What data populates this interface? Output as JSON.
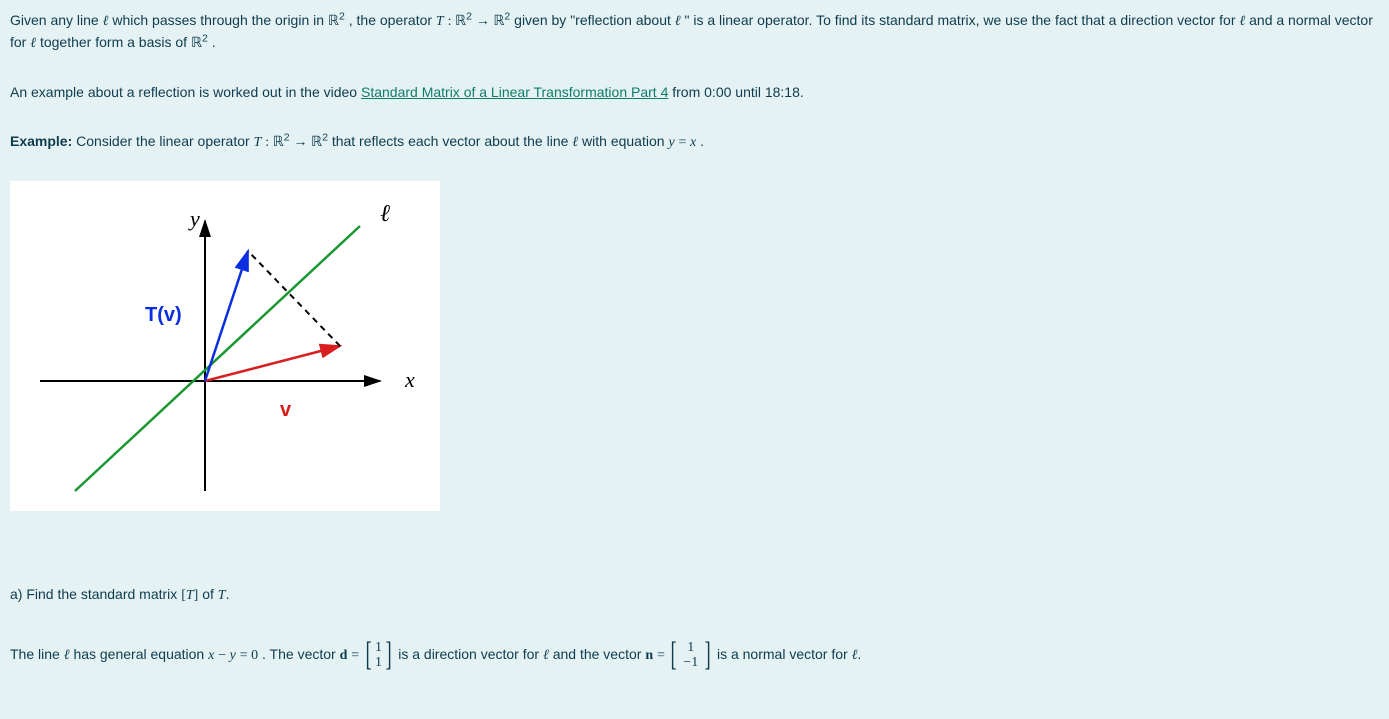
{
  "para1": {
    "t1": "Given any line ",
    "ell1": "ℓ",
    "t2": " which passes through the origin in ",
    "R": "ℝ",
    "sq": "2",
    "t3": ", the operator ",
    "T": "T",
    "colon": " : ",
    "arrow": " → ",
    "t4": " given by \"reflection about ",
    "ell2": "ℓ",
    "t5": "\" is a linear operator.  To find its standard matrix, we use the fact that a direction vector for  ",
    "ell3": "ℓ",
    "t6": " and a normal vector for ",
    "ell4": "ℓ",
    "t7": " together form a basis of  ",
    "period": "."
  },
  "para2": {
    "t1": "An example about a reflection is worked out in the video ",
    "link": "Standard Matrix of a Linear Transformation Part 4",
    "t2": " from 0:00 until 18:18."
  },
  "para3": {
    "label": "Example:",
    "t1": "  Consider the linear operator ",
    "T": "T",
    "colon": " : ",
    "R": "ℝ",
    "sq": "2",
    "arrow": " → ",
    "t2": " that reflects each vector about the line ",
    "ell": "ℓ",
    "t3": " with equation ",
    "y": "y",
    "eq": " = ",
    "x": "x",
    "period": "."
  },
  "figure": {
    "y_label": "y",
    "ell_label": "ℓ",
    "Tv_label": "T(v)",
    "v_label": "v",
    "x_label": "x"
  },
  "qa": {
    "t1": "a) Find the standard matrix ",
    "lb": "[",
    "T": "T",
    "rb": "]",
    "t2": " of ",
    "T2": "T",
    "period": "."
  },
  "last": {
    "t1": "The line ",
    "ell1": "ℓ",
    "t2": " has  general equation ",
    "x": "x",
    "minus": " − ",
    "y": "y",
    "eq0": " = 0",
    "t3": ".  The vector ",
    "d": "d",
    "eqs": " = ",
    "d_top": "1",
    "d_bot": "1",
    "t4": "  is a direction vector for ",
    "ell2": "ℓ",
    "t5": " and the vector ",
    "n": "n",
    "n_top": "1",
    "n_bot": "−1",
    "t6": "  is a normal vector for ",
    "ell3": "ℓ",
    "period": "."
  }
}
